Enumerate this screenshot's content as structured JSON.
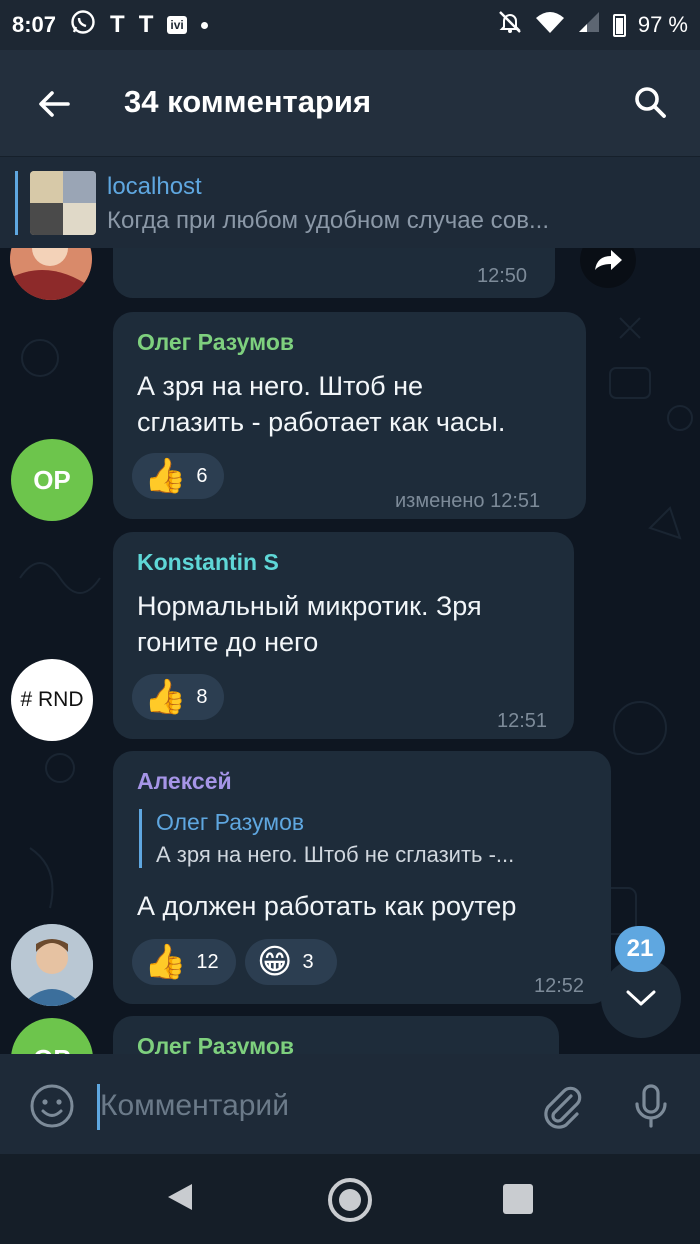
{
  "status_bar": {
    "time": "8:07",
    "icons_left": [
      "whatsapp-icon",
      "t-icon",
      "t-icon",
      "ivi-icon",
      "dot-icon"
    ],
    "t_label": "T",
    "ivi_label": "ivi",
    "icons_right": [
      "mute-icon",
      "wifi-icon",
      "signal-icon",
      "battery-icon"
    ],
    "battery": "97 %"
  },
  "header": {
    "title": "34 комментария"
  },
  "pinned": {
    "channel": "localhost",
    "preview": "Когда при любом удобном случае сов..."
  },
  "messages": [
    {
      "time": "12:50"
    },
    {
      "sender": "Олег Разумов",
      "sender_color": "#7ed07e",
      "avatar_initials": "OP",
      "avatar_color": "#6dc54c",
      "text_line1": "А зря на него. Штоб не",
      "text_line2": "сглазить - работает как часы.",
      "reactions": [
        {
          "emoji": "👍",
          "count": "6"
        }
      ],
      "time": "изменено 12:51"
    },
    {
      "sender": "Konstantin S",
      "sender_color": "#5fd7d7",
      "avatar_initials": "# RND",
      "avatar_color": "#ffffff",
      "text_line1": "Нормальный микротик. Зря",
      "text_line2": "гоните до него",
      "reactions": [
        {
          "emoji": "👍",
          "count": "8"
        }
      ],
      "time": "12:51"
    },
    {
      "sender": "Алексей",
      "sender_color": "#a695e7",
      "reply": {
        "name": "Олег Разумов",
        "text": "А зря на него. Штоб не сглазить -..."
      },
      "text_line1": "А должен работать как роутер",
      "reactions": [
        {
          "emoji": "👍",
          "count": "12"
        },
        {
          "emoji": "😁",
          "count": "3"
        }
      ],
      "time": "12:52"
    },
    {
      "sender": "Олег Разумов",
      "sender_color": "#7ed07e",
      "avatar_initials": "OP"
    }
  ],
  "scroll": {
    "unread_count": "21"
  },
  "composer": {
    "placeholder": "Комментарий"
  },
  "colors": {
    "accent": "#5fa7e0",
    "background": "#0e1621",
    "bubble": "#1e2c3a"
  }
}
